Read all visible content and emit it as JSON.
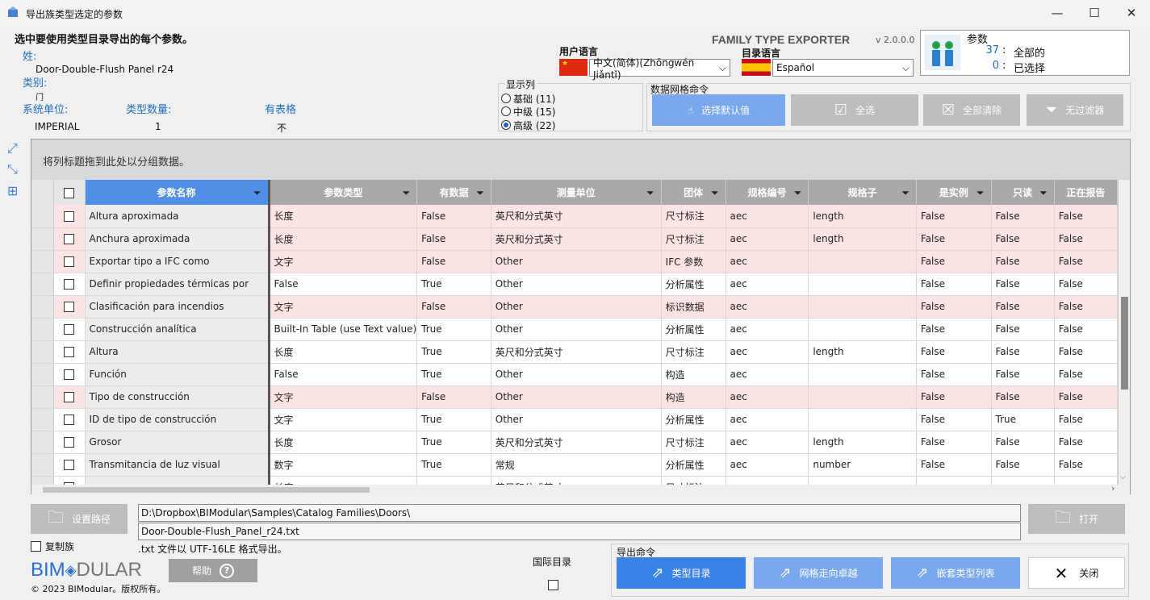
{
  "window": {
    "title": "导出族类型选定的参数"
  },
  "header": {
    "instruction": "选中要使用类型目录导出的每个参数。",
    "family_label": "姓:",
    "family_value": "Door-Double-Flush  Panel  r24",
    "category_label": "类别:",
    "category_value": "门",
    "units_label": "系统单位:",
    "units_value": "IMPERIAL",
    "type_count_label": "类型数量:",
    "type_count_value": "1",
    "has_table_label": "有表格",
    "has_table_value": "不"
  },
  "product": {
    "name": "FAMILY TYPE EXPORTER",
    "version": "v 2.0.0.0"
  },
  "language": {
    "user_label": "用户语言",
    "user_value": "中文(简体)(Zhōngwén Jiǎntǐ)",
    "catalog_label": "目录语言",
    "catalog_value": "Español"
  },
  "params": {
    "title": "参数",
    "total_count": "37",
    "total_label": "全部的",
    "selected_count": "0",
    "selected_label": "已选择",
    "colon": ":"
  },
  "columns_group": {
    "title": "显示列",
    "options": [
      {
        "label": "基础 (11)",
        "checked": false
      },
      {
        "label": "中级 (15)",
        "checked": false
      },
      {
        "label": "高级 (22)",
        "checked": true
      }
    ]
  },
  "grid_commands": {
    "title": "数据网格命令",
    "select_default": "选择默认值",
    "select_all": "全选",
    "clear_all": "全部清除",
    "no_filter": "无过滤器"
  },
  "grid": {
    "group_hint": "将列标题拖到此处以分组数据。",
    "columns": [
      "参数名称",
      "参数类型",
      "有数据",
      "测量单位",
      "团体",
      "规格编号",
      "规格子",
      "是实例",
      "只读",
      "正在报告"
    ],
    "rows": [
      {
        "pink": true,
        "cells": [
          "Altura aproximada",
          "长度",
          "False",
          "英尺和分式英寸",
          "尺寸标注",
          "aec",
          "length",
          "False",
          "False",
          "False"
        ]
      },
      {
        "pink": true,
        "cells": [
          "Anchura aproximada",
          "长度",
          "False",
          "英尺和分式英寸",
          "尺寸标注",
          "aec",
          "length",
          "False",
          "False",
          "False"
        ]
      },
      {
        "pink": true,
        "cells": [
          "Exportar tipo a IFC como",
          "文字",
          "False",
          "Other",
          "IFC 参数",
          "aec",
          "",
          "False",
          "False",
          "False"
        ]
      },
      {
        "pink": false,
        "cells": [
          "Definir propiedades térmicas por",
          "False",
          "True",
          "Other",
          "分析属性",
          "aec",
          "",
          "False",
          "False",
          "False"
        ]
      },
      {
        "pink": true,
        "cells": [
          "Clasificación para incendios",
          "文字",
          "False",
          "Other",
          "标识数据",
          "aec",
          "",
          "False",
          "False",
          "False"
        ]
      },
      {
        "pink": false,
        "cells": [
          "Construcción analítica",
          "Built-In Table (use Text value)",
          "True",
          "Other",
          "分析属性",
          "aec",
          "",
          "False",
          "False",
          "False"
        ]
      },
      {
        "pink": false,
        "cells": [
          "Altura",
          "长度",
          "True",
          "英尺和分式英寸",
          "尺寸标注",
          "aec",
          "length",
          "False",
          "False",
          "False"
        ]
      },
      {
        "pink": false,
        "cells": [
          "Función",
          "False",
          "True",
          "Other",
          "构造",
          "aec",
          "",
          "False",
          "False",
          "False"
        ]
      },
      {
        "pink": true,
        "cells": [
          "Tipo de construcción",
          "文字",
          "False",
          "Other",
          "构造",
          "aec",
          "",
          "False",
          "False",
          "False"
        ]
      },
      {
        "pink": false,
        "cells": [
          "ID de tipo de construcción",
          "文字",
          "True",
          "Other",
          "分析属性",
          "aec",
          "",
          "False",
          "True",
          "False"
        ]
      },
      {
        "pink": false,
        "cells": [
          "Grosor",
          "长度",
          "True",
          "英尺和分式英寸",
          "尺寸标注",
          "aec",
          "length",
          "False",
          "False",
          "False"
        ]
      },
      {
        "pink": false,
        "cells": [
          "Transmitancia de luz visual",
          "数字",
          "True",
          "常规",
          "分析属性",
          "aec",
          "number",
          "False",
          "False",
          "False"
        ]
      },
      {
        "pink": false,
        "cells": [
          "",
          "长度",
          "",
          "英尺和分式英寸",
          "尺寸标注",
          "",
          "",
          "",
          "",
          ""
        ]
      }
    ]
  },
  "footer": {
    "set_path": "设置路径",
    "path_value": "D:\\Dropbox\\BIModular\\Samples\\Catalog Families\\Doors\\",
    "file_value": "Door-Double-Flush_Panel_r24.txt",
    "open": "打开",
    "copy_family": "复制族",
    "encoding_note": ".txt 文件以 UTF-16LE 格式导出。",
    "logo_bim": "BIM",
    "logo_rest": "DULAR",
    "copyright": "© 2023 BIModular。版权所有。",
    "help": "帮助",
    "intl_catalog": "国际目录",
    "export_title": "导出命令",
    "type_catalog": "类型目录",
    "grid_excel": "网格走向卓越",
    "nested_types": "嵌套类型列表",
    "close": "关闭"
  },
  "colors": {
    "accent": "#3b82e6",
    "pink_row": "#fde4e4",
    "header_gray": "#a9a9a9",
    "label_blue": "#1f6fbf"
  }
}
